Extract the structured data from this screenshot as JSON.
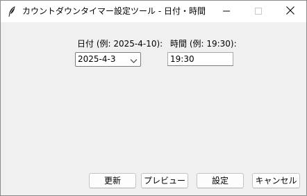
{
  "window": {
    "title": "カウントダウンタイマー設定ツール - 日付・時間"
  },
  "titlebar_controls": {
    "minimize_icon": "minimize-icon",
    "maximize_icon": "maximize-icon",
    "close_icon": "close-icon",
    "app_icon": "feather-icon"
  },
  "form": {
    "date_label": "日付 (例: 2025-4-10):",
    "date_value": "2025-4-3",
    "time_label": "時間 (例: 19:30):",
    "time_value": "19:30"
  },
  "buttons": {
    "update": "更新",
    "preview": "プレビュー",
    "settings": "設定",
    "cancel": "キャンセル"
  },
  "colors": {
    "window_background": "#f0f0f0",
    "titlebar_background": "#ffffff",
    "field_background": "#ffffff"
  }
}
